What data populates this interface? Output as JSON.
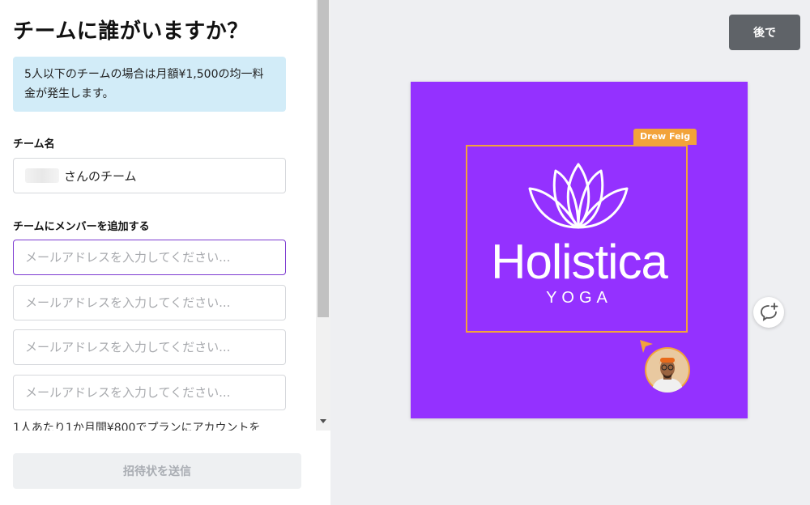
{
  "panel": {
    "title": "チームに誰がいますか？",
    "info": "5人以下のチームの場合は月額¥1,500の均一料金が発生します。",
    "team_name_label": "チーム名",
    "team_name_value": "さんのチーム",
    "add_members_label": "チームにメンバーを追加する",
    "email_placeholder": "メールアドレスを入力してください...",
    "note": "1人あたり1か月間¥800でプランにアカウントを",
    "send_button": "招待状を送信"
  },
  "header": {
    "later_button": "後で"
  },
  "canvas": {
    "background_color": "#9431ff",
    "accent_color": "#f2a33a",
    "collaborator_name": "Drew Feig",
    "brand_name": "Holistica",
    "brand_sub": "YOGA",
    "logo_icon": "lotus-icon"
  },
  "icons": {
    "comment": "add-comment-icon"
  }
}
